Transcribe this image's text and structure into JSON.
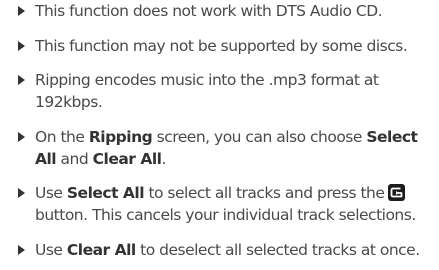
{
  "notes": [
    {
      "lines": [
        "This function does not work with DTS Audio CD."
      ]
    },
    {
      "lines": [
        "This function may not be supported by some discs."
      ]
    },
    {
      "lines": [
        "Ripping encodes music into the .mp3 format at",
        "192kbps."
      ]
    },
    {
      "l1_pre": "On the ",
      "l1_bold": "Ripping",
      "l1_mid": " screen, you can also choose ",
      "l1_bold2": "Select",
      "l2_bold": "All",
      "l2_mid": " and ",
      "l2_bold2": "Clear All",
      "l2_post": "."
    },
    {
      "l1_pre": "Use ",
      "l1_bold": "Select All",
      "l1_post": " to select all tracks and press the",
      "button_icon": "return-button-icon",
      "l2": "button. This cancels your individual track selections."
    },
    {
      "l1_pre": "Use ",
      "l1_bold": "Clear All",
      "l1_post": " to deselect all selected tracks at once."
    }
  ],
  "colors": {
    "text": "#4a4a4a",
    "bold_text": "#333333",
    "bullet": "#333333",
    "icon_bg": "#1c1c1c",
    "icon_fg": "#ffffff"
  }
}
